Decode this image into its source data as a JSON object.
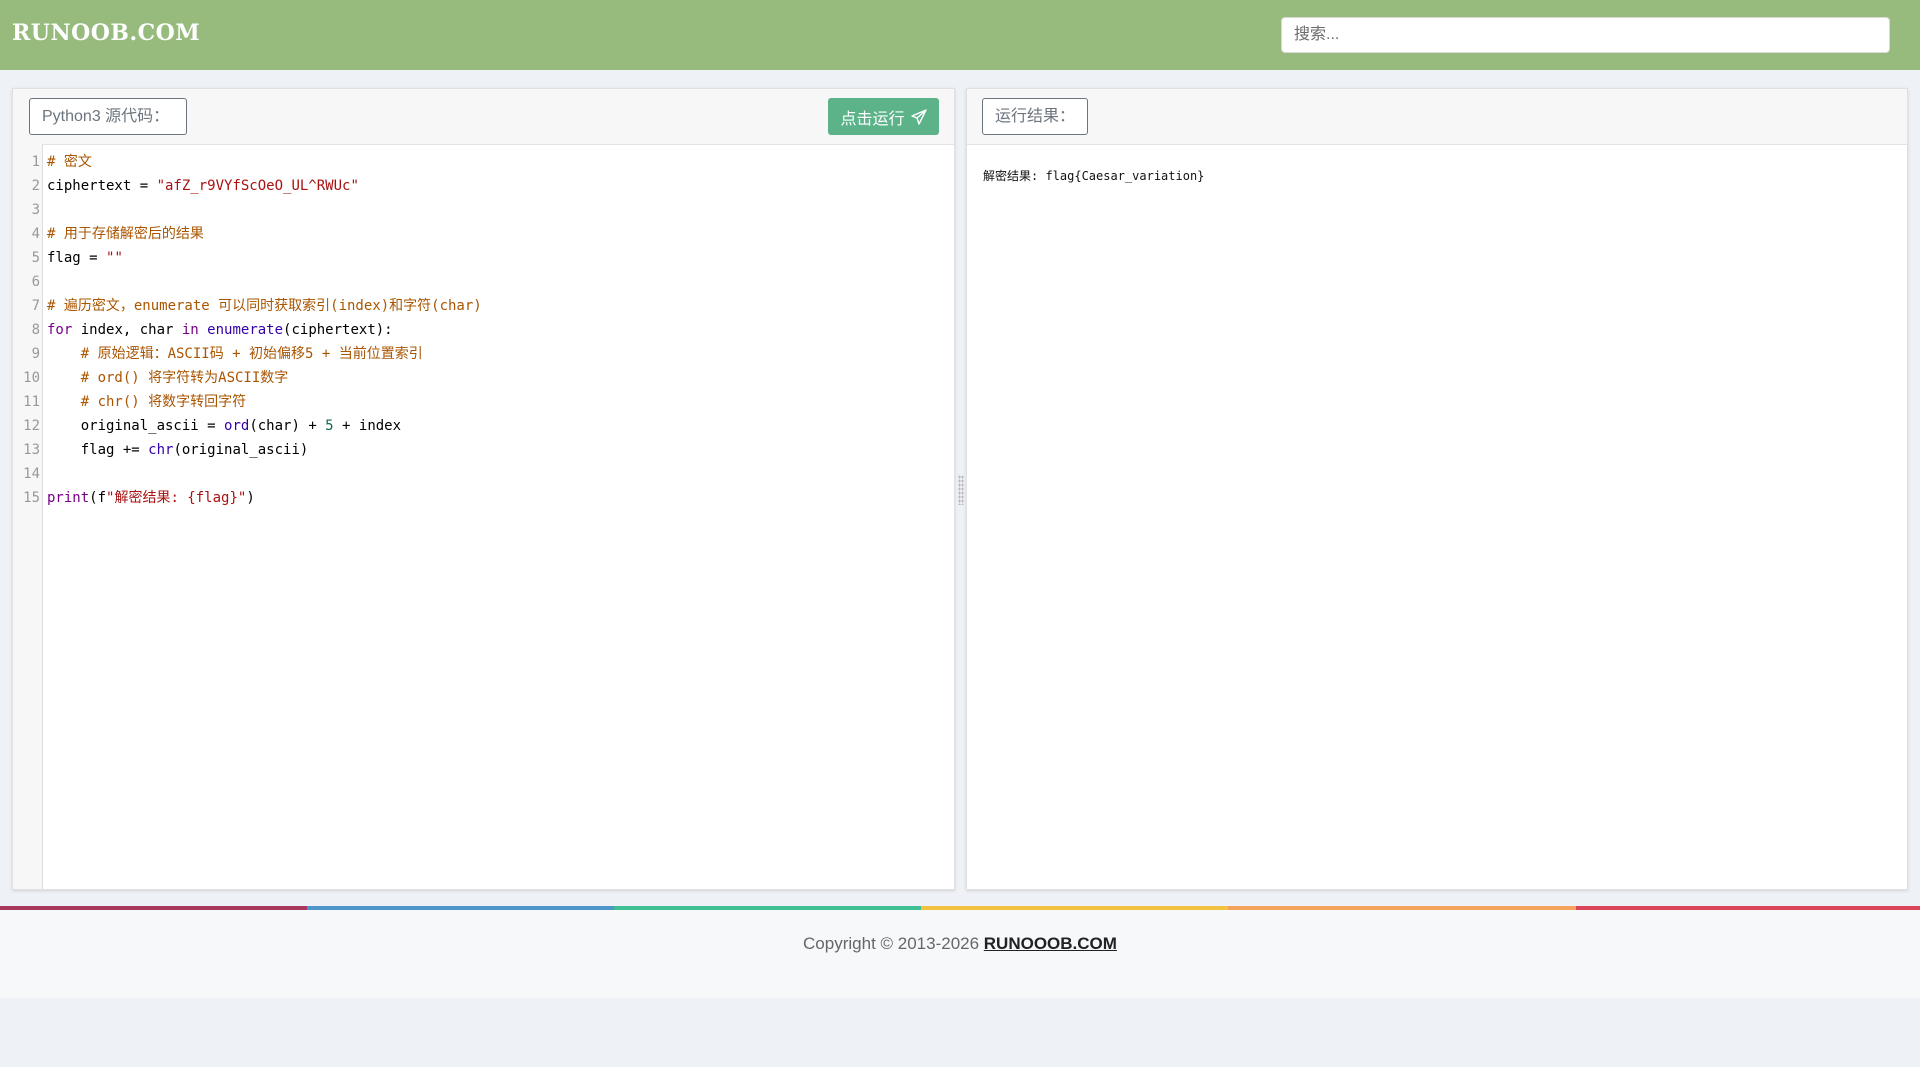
{
  "header": {
    "logo": "RUNOOB.COM",
    "search_placeholder": "搜索..."
  },
  "editor_panel": {
    "label": "Python3 源代码：",
    "run_button": "点击运行"
  },
  "result_panel": {
    "label": "运行结果：",
    "output": "解密结果: flag{Caesar_variation}"
  },
  "code_lines": [
    {
      "n": "1",
      "tokens": [
        {
          "t": "# 密文",
          "c": "com"
        }
      ]
    },
    {
      "n": "2",
      "tokens": [
        {
          "t": "ciphertext = ",
          "c": ""
        },
        {
          "t": "\"afZ_r9VYfScOeO_UL^RWUc\"",
          "c": "str"
        }
      ]
    },
    {
      "n": "3",
      "tokens": []
    },
    {
      "n": "4",
      "tokens": [
        {
          "t": "# 用于存储解密后的结果",
          "c": "com"
        }
      ]
    },
    {
      "n": "5",
      "tokens": [
        {
          "t": "flag = ",
          "c": ""
        },
        {
          "t": "\"\"",
          "c": "str"
        }
      ]
    },
    {
      "n": "6",
      "tokens": []
    },
    {
      "n": "7",
      "tokens": [
        {
          "t": "# 遍历密文，enumerate 可以同时获取索引(index)和字符(char)",
          "c": "com"
        }
      ]
    },
    {
      "n": "8",
      "tokens": [
        {
          "t": "for",
          "c": "kw"
        },
        {
          "t": " index, char ",
          "c": ""
        },
        {
          "t": "in",
          "c": "kw"
        },
        {
          "t": " ",
          "c": ""
        },
        {
          "t": "enumerate",
          "c": "bi"
        },
        {
          "t": "(ciphertext):",
          "c": ""
        }
      ]
    },
    {
      "n": "9",
      "tokens": [
        {
          "t": "    ",
          "c": ""
        },
        {
          "t": "# 原始逻辑：ASCII码 + 初始偏移5 + 当前位置索引",
          "c": "com"
        }
      ]
    },
    {
      "n": "10",
      "tokens": [
        {
          "t": "    ",
          "c": ""
        },
        {
          "t": "# ord() 将字符转为ASCII数字",
          "c": "com"
        }
      ]
    },
    {
      "n": "11",
      "tokens": [
        {
          "t": "    ",
          "c": ""
        },
        {
          "t": "# chr() 将数字转回字符",
          "c": "com"
        }
      ]
    },
    {
      "n": "12",
      "tokens": [
        {
          "t": "    original_ascii = ",
          "c": ""
        },
        {
          "t": "ord",
          "c": "bi"
        },
        {
          "t": "(char) + ",
          "c": ""
        },
        {
          "t": "5",
          "c": "num"
        },
        {
          "t": " + index",
          "c": ""
        }
      ]
    },
    {
      "n": "13",
      "tokens": [
        {
          "t": "    flag += ",
          "c": ""
        },
        {
          "t": "chr",
          "c": "bi"
        },
        {
          "t": "(original_ascii)",
          "c": ""
        }
      ]
    },
    {
      "n": "14",
      "tokens": []
    },
    {
      "n": "15",
      "tokens": [
        {
          "t": "print",
          "c": "kw"
        },
        {
          "t": "(f",
          "c": ""
        },
        {
          "t": "\"解密结果: {flag}\"",
          "c": "str"
        },
        {
          "t": ")",
          "c": ""
        }
      ]
    }
  ],
  "footer": {
    "copyright_prefix": "Copyright © 2013-2026 ",
    "link": "RUNOOOB.COM"
  },
  "colors": {
    "header_bg": "#96bb7c",
    "run_button_bg": "#5cb38a",
    "rainbow": [
      "#a8375e",
      "#4c96c9",
      "#3dbf93",
      "#f3c241",
      "#f3a35c",
      "#d94459"
    ]
  }
}
